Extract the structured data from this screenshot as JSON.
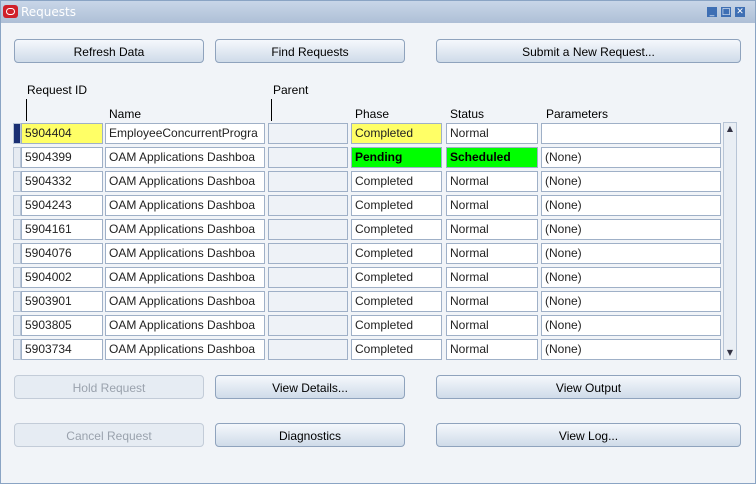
{
  "window": {
    "title": "Requests"
  },
  "buttons": {
    "refresh": "Refresh Data",
    "find": "Find Requests",
    "submit": "Submit a New Request...",
    "hold": "Hold Request",
    "view_details": "View Details...",
    "view_output": "View Output",
    "cancel": "Cancel Request",
    "diagnostics": "Diagnostics",
    "view_log": "View Log..."
  },
  "headers": {
    "request_id": "Request ID",
    "parent": "Parent",
    "name": "Name",
    "phase": "Phase",
    "status": "Status",
    "parameters": "Parameters"
  },
  "rows": [
    {
      "request_id": "5904404",
      "name": "EmployeeConcurrentProgra",
      "parent": "",
      "phase": "Completed",
      "status": "Normal",
      "parameters": ""
    },
    {
      "request_id": "5904399",
      "name": "OAM Applications Dashboa",
      "parent": "",
      "phase": "Pending",
      "status": "Scheduled",
      "parameters": "(None)"
    },
    {
      "request_id": "5904332",
      "name": "OAM Applications Dashboa",
      "parent": "",
      "phase": "Completed",
      "status": "Normal",
      "parameters": "(None)"
    },
    {
      "request_id": "5904243",
      "name": "OAM Applications Dashboa",
      "parent": "",
      "phase": "Completed",
      "status": "Normal",
      "parameters": "(None)"
    },
    {
      "request_id": "5904161",
      "name": "OAM Applications Dashboa",
      "parent": "",
      "phase": "Completed",
      "status": "Normal",
      "parameters": "(None)"
    },
    {
      "request_id": "5904076",
      "name": "OAM Applications Dashboa",
      "parent": "",
      "phase": "Completed",
      "status": "Normal",
      "parameters": "(None)"
    },
    {
      "request_id": "5904002",
      "name": "OAM Applications Dashboa",
      "parent": "",
      "phase": "Completed",
      "status": "Normal",
      "parameters": "(None)"
    },
    {
      "request_id": "5903901",
      "name": "OAM Applications Dashboa",
      "parent": "",
      "phase": "Completed",
      "status": "Normal",
      "parameters": "(None)"
    },
    {
      "request_id": "5903805",
      "name": "OAM Applications Dashboa",
      "parent": "",
      "phase": "Completed",
      "status": "Normal",
      "parameters": "(None)"
    },
    {
      "request_id": "5903734",
      "name": "OAM Applications Dashboa",
      "parent": "",
      "phase": "Completed",
      "status": "Normal",
      "parameters": "(None)"
    }
  ],
  "colors": {
    "pending": "#00ff00",
    "highlight": "#ffff66",
    "current_row_marker": "#1a2f73"
  },
  "icons": {
    "app": "oracle-logo-icon",
    "minimize": "minimize-icon",
    "maximize": "maximize-icon",
    "close": "close-icon"
  }
}
